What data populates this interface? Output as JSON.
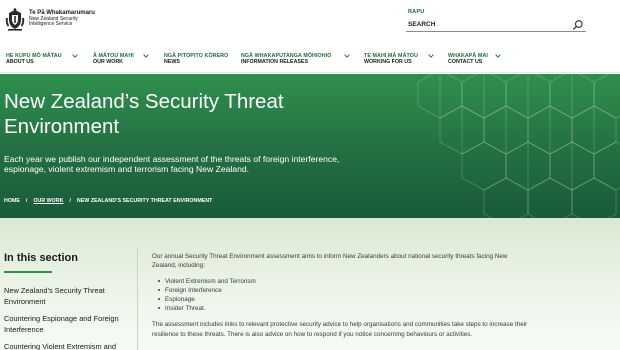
{
  "header": {
    "logo": {
      "maori": "Te Pā Whakamarumaru",
      "english_line1": "New Zealand Security",
      "english_line2": "Intelligence Service"
    },
    "search": {
      "label": "RAPU",
      "placeholder": "SEARCH"
    }
  },
  "nav": {
    "items": [
      {
        "maori": "HE KUPU MŌ MĀTAU",
        "english": "ABOUT US",
        "has_dropdown": true
      },
      {
        "maori": "Ā MĀTOU MAHI",
        "english": "OUR WORK",
        "has_dropdown": true
      },
      {
        "maori": "NGĀ PITOPITO KŌRERO",
        "english": "NEWS",
        "has_dropdown": false
      },
      {
        "maori": "NGĀ WHAKAPUTANGA MŌHIOHIO",
        "english": "INFORMATION RELEASES",
        "has_dropdown": true
      },
      {
        "maori": "TE MAHI MĀ MĀTOU",
        "english": "WORKING FOR US",
        "has_dropdown": true
      },
      {
        "maori": "WHAKAPĀ MAI",
        "english": "CONTACT US",
        "has_dropdown": true
      }
    ]
  },
  "hero": {
    "title": "New Zealand’s Security Threat Environment",
    "description": "Each year we publish our independent assessment of the threats of foreign interference, espionage, violent extremism and terrorism facing New Zealand.",
    "breadcrumb": [
      "HOME",
      "OUR WORK",
      "NEW ZEALAND’S SECURITY THREAT ENVIRONMENT"
    ]
  },
  "sidebar": {
    "title": "In this section",
    "links": [
      "New Zealand’s Security Threat Environment",
      "Countering Espionage and Foreign Interference",
      "Countering Violent Extremism and"
    ]
  },
  "main": {
    "intro": "Our annual Security Threat Environment assessment aims to inform New Zealanders about national security threats facing New Zealand, including:",
    "bullets": [
      "Violent Extremism and Terrorism",
      "Foreign Interference",
      "Espionage",
      "Insider Threat."
    ],
    "paragraph2": "The assessment includes links to relevant protective security advice to help organisations and communities take steps to increase their resilience to these threats. There is also advice on how to respond if you notice concerning behaviours or activities."
  },
  "colors": {
    "brand_green": "#2f8f4e",
    "dark_green": "#1a5a3a",
    "nav_maori": "#1c6b3a",
    "content_bg": "#e4efde"
  },
  "icons": [
    "nz-coat-of-arms-icon",
    "search-icon",
    "chevron-down-icon",
    "hexagon-pattern"
  ]
}
